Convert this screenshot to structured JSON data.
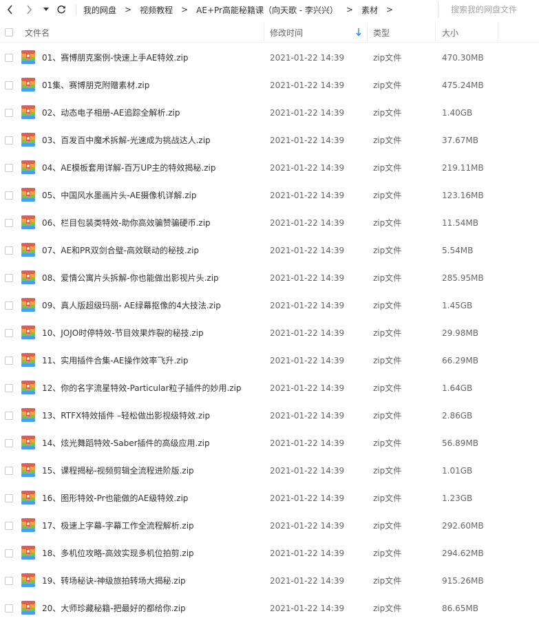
{
  "nav": {
    "back_icon": "chevron-left-icon",
    "forward_icon": "chevron-right-icon",
    "history_icon": "caret-down-icon",
    "refresh_icon": "refresh-icon"
  },
  "breadcrumb": {
    "items": [
      "我的网盘",
      "视频教程",
      "AE+Pr高能秘籍课（向天歌 - 李兴兴）",
      "素材"
    ],
    "separator": ">"
  },
  "search": {
    "placeholder": "搜索我的网盘文件"
  },
  "columns": {
    "name": "文件名",
    "modified": "修改时间",
    "type": "类型",
    "size": "大小"
  },
  "sort": {
    "column": "修改时间",
    "direction": "descending"
  },
  "colors": {
    "accent": "#2e8ae6",
    "zip_red": "#e45b4f",
    "zip_orange": "#f2a33a",
    "zip_green": "#7cc34e",
    "zip_blue": "#4a9de8"
  },
  "files": [
    {
      "name": "01、赛博朋克案例-快速上手AE特效.zip",
      "modified": "2021-01-22 14:39",
      "type": "zip文件",
      "size": "470.30MB"
    },
    {
      "name": "01集、赛博朋克附赠素材.zip",
      "modified": "2021-01-22 14:39",
      "type": "zip文件",
      "size": "475.24MB"
    },
    {
      "name": "02、动态电子相册-AE追踪全解析.zip",
      "modified": "2021-01-22 14:39",
      "type": "zip文件",
      "size": "1.40GB"
    },
    {
      "name": "03、百发百中魔术拆解-光速成为挑战达人.zip",
      "modified": "2021-01-22 14:39",
      "type": "zip文件",
      "size": "37.67MB"
    },
    {
      "name": "04、AE模板套用详解-百万UP主的特效揭秘.zip",
      "modified": "2021-01-22 14:39",
      "type": "zip文件",
      "size": "219.11MB"
    },
    {
      "name": "05、中国风水墨画片头-AE摄像机详解.zip",
      "modified": "2021-01-22 14:39",
      "type": "zip文件",
      "size": "123.16MB"
    },
    {
      "name": "06、栏目包装类特效-助你高效骗赞骗硬币.zip",
      "modified": "2021-01-22 14:39",
      "type": "zip文件",
      "size": "11.54MB"
    },
    {
      "name": "07、AE和PR双剑合璧-高效联动的秘技.zip",
      "modified": "2021-01-22 14:39",
      "type": "zip文件",
      "size": "5.54MB"
    },
    {
      "name": "08、爱情公寓片头拆解-你也能做出影视片头.zip",
      "modified": "2021-01-22 14:39",
      "type": "zip文件",
      "size": "285.95MB"
    },
    {
      "name": "09、真人版超级玛丽- AE绿幕抠像的4大技法.zip",
      "modified": "2021-01-22 14:39",
      "type": "zip文件",
      "size": "1.45GB"
    },
    {
      "name": "10、JOJO时停特效-节目效果炸裂的秘技.zip",
      "modified": "2021-01-22 14:39",
      "type": "zip文件",
      "size": "29.98MB"
    },
    {
      "name": "11、实用插件合集-AE操作效率飞升.zip",
      "modified": "2021-01-22 14:39",
      "type": "zip文件",
      "size": "66.29MB"
    },
    {
      "name": "12、你的名字流星特效-Particular粒子插件的妙用.zip",
      "modified": "2021-01-22 14:39",
      "type": "zip文件",
      "size": "1.64GB"
    },
    {
      "name": "13、RTFX特效插件 –轻松做出影视级特效.zip",
      "modified": "2021-01-22 14:39",
      "type": "zip文件",
      "size": "2.86GB"
    },
    {
      "name": "14、炫光舞蹈特效-Saber插件的高级应用.zip",
      "modified": "2021-01-22 14:39",
      "type": "zip文件",
      "size": "56.89MB"
    },
    {
      "name": "15、课程揭秘-视频剪辑全流程进阶版.zip",
      "modified": "2021-01-22 14:39",
      "type": "zip文件",
      "size": "1.01GB"
    },
    {
      "name": "16、图形特效-Pr也能做的AE级特效.zip",
      "modified": "2021-01-22 14:39",
      "type": "zip文件",
      "size": "1.23GB"
    },
    {
      "name": "17、极速上字幕-字幕工作全流程解析.zip",
      "modified": "2021-01-22 14:39",
      "type": "zip文件",
      "size": "292.60MB"
    },
    {
      "name": "18、多机位攻略-高效实现多机位拍剪.zip",
      "modified": "2021-01-22 14:39",
      "type": "zip文件",
      "size": "294.62MB"
    },
    {
      "name": "19、转场秘诀-神级旅拍转场大揭秘.zip",
      "modified": "2021-01-22 14:39",
      "type": "zip文件",
      "size": "915.26MB"
    },
    {
      "name": "20、大师珍藏秘籍-把最好的都给你.zip",
      "modified": "2021-01-22 14:39",
      "type": "zip文件",
      "size": "86.65MB"
    }
  ]
}
